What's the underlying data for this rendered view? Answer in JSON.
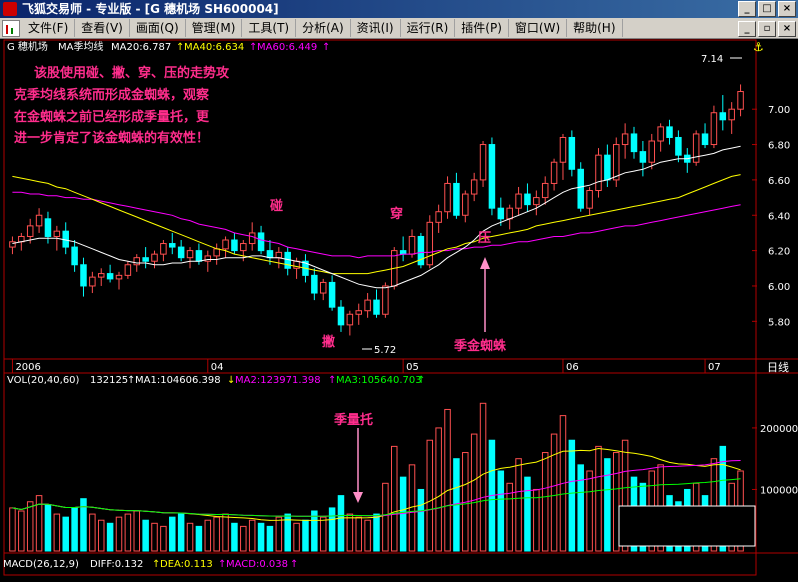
{
  "window": {
    "title": "飞狐交易师 - 专业版 - [G 穗机场 SH600004]"
  },
  "menu": [
    "文件(F)",
    "查看(V)",
    "画面(Q)",
    "管理(M)",
    "工具(T)",
    "分析(A)",
    "资讯(I)",
    "运行(R)",
    "插件(P)",
    "窗口(W)",
    "帮助(H)"
  ],
  "colors": {
    "up": "#ff5050",
    "down": "#00ffff",
    "ma20": "#ffffff",
    "ma40": "#ffff00",
    "ma60": "#ff00ff",
    "annotation": "#ff2d8c",
    "axis": "#b00000"
  },
  "price_header": {
    "stock": "G 穗机场",
    "indicator": "MA季均线",
    "ma20": "MA20:6.787",
    "ma40": "MA40:6.634",
    "ma60": "MA60:6.449"
  },
  "annotation_text": [
    "该股使用碰、撇、穿、压的走势攻",
    "克季均线系统而形成金蜘蛛，观察",
    "在金蜘蛛之前已经形成季量托，更",
    "进一步肯定了该金蜘蛛的有效性！"
  ],
  "labels": {
    "peng": "碰",
    "pie": "撇",
    "chuan": "穿",
    "ya": "压",
    "jijinzhizhu": "季金蜘蛛",
    "jiliangtuo": "季量托",
    "low": "5.72",
    "high": "7.14"
  },
  "price_axis": [
    "7.00",
    "6.80",
    "6.60",
    "6.40",
    "6.20",
    "6.00",
    "5.80"
  ],
  "date_axis": [
    "2006",
    "04",
    "05",
    "06",
    "07"
  ],
  "period_label": "日线",
  "vol_header": {
    "name": "VOL(20,40,60)",
    "value": "132125",
    "ma1": "MA1:104606.398",
    "ma2": "MA2:123971.398",
    "ma3": "MA3:105640.703"
  },
  "vol_axis": [
    "200000",
    "100000"
  ],
  "macd_header": {
    "name": "MACD(26,12,9)",
    "diff": "DIFF:0.132",
    "dea": "DEA:0.113",
    "macd": "MACD:0.038"
  },
  "chart_data": {
    "type": "candlestick",
    "ylim": [
      5.7,
      7.25
    ],
    "candles": [
      [
        6.22,
        6.28,
        6.18,
        6.25
      ],
      [
        6.25,
        6.3,
        6.2,
        6.28
      ],
      [
        6.28,
        6.38,
        6.24,
        6.34
      ],
      [
        6.34,
        6.44,
        6.3,
        6.4
      ],
      [
        6.38,
        6.42,
        6.24,
        6.28
      ],
      [
        6.28,
        6.34,
        6.2,
        6.31
      ],
      [
        6.31,
        6.36,
        6.18,
        6.22
      ],
      [
        6.22,
        6.26,
        6.08,
        6.12
      ],
      [
        6.12,
        6.16,
        5.94,
        6.0
      ],
      [
        6.0,
        6.08,
        5.96,
        6.05
      ],
      [
        6.05,
        6.1,
        6.0,
        6.07
      ],
      [
        6.07,
        6.12,
        6.02,
        6.04
      ],
      [
        6.04,
        6.08,
        5.98,
        6.06
      ],
      [
        6.06,
        6.14,
        6.04,
        6.12
      ],
      [
        6.12,
        6.18,
        6.08,
        6.16
      ],
      [
        6.16,
        6.22,
        6.1,
        6.14
      ],
      [
        6.14,
        6.2,
        6.1,
        6.18
      ],
      [
        6.18,
        6.26,
        6.14,
        6.24
      ],
      [
        6.24,
        6.3,
        6.18,
        6.22
      ],
      [
        6.22,
        6.26,
        6.14,
        6.16
      ],
      [
        6.16,
        6.22,
        6.1,
        6.2
      ],
      [
        6.2,
        6.24,
        6.12,
        6.14
      ],
      [
        6.14,
        6.2,
        6.08,
        6.17
      ],
      [
        6.17,
        6.24,
        6.12,
        6.21
      ],
      [
        6.21,
        6.28,
        6.16,
        6.26
      ],
      [
        6.26,
        6.3,
        6.18,
        6.2
      ],
      [
        6.2,
        6.26,
        6.14,
        6.24
      ],
      [
        6.24,
        6.36,
        6.2,
        6.3
      ],
      [
        6.3,
        6.34,
        6.18,
        6.2
      ],
      [
        6.2,
        6.26,
        6.12,
        6.16
      ],
      [
        6.16,
        6.22,
        6.1,
        6.19
      ],
      [
        6.19,
        6.22,
        6.06,
        6.1
      ],
      [
        6.1,
        6.16,
        6.04,
        6.14
      ],
      [
        6.14,
        6.18,
        6.02,
        6.06
      ],
      [
        6.06,
        6.1,
        5.92,
        5.96
      ],
      [
        5.96,
        6.04,
        5.92,
        6.02
      ],
      [
        6.02,
        6.06,
        5.86,
        5.88
      ],
      [
        5.88,
        5.92,
        5.74,
        5.78
      ],
      [
        5.78,
        5.86,
        5.72,
        5.84
      ],
      [
        5.84,
        5.9,
        5.78,
        5.86
      ],
      [
        5.86,
        5.96,
        5.82,
        5.92
      ],
      [
        5.92,
        5.98,
        5.82,
        5.84
      ],
      [
        5.84,
        6.02,
        5.82,
        6.0
      ],
      [
        6.0,
        6.22,
        5.98,
        6.2
      ],
      [
        6.2,
        6.28,
        6.14,
        6.18
      ],
      [
        6.18,
        6.32,
        6.16,
        6.28
      ],
      [
        6.28,
        6.3,
        6.1,
        6.12
      ],
      [
        6.12,
        6.4,
        6.1,
        6.36
      ],
      [
        6.36,
        6.46,
        6.3,
        6.42
      ],
      [
        6.42,
        6.62,
        6.38,
        6.58
      ],
      [
        6.58,
        6.64,
        6.38,
        6.4
      ],
      [
        6.4,
        6.54,
        6.36,
        6.52
      ],
      [
        6.52,
        6.64,
        6.48,
        6.6
      ],
      [
        6.6,
        6.82,
        6.56,
        6.8
      ],
      [
        6.8,
        6.84,
        6.4,
        6.44
      ],
      [
        6.44,
        6.5,
        6.34,
        6.38
      ],
      [
        6.38,
        6.46,
        6.32,
        6.44
      ],
      [
        6.44,
        6.56,
        6.4,
        6.52
      ],
      [
        6.52,
        6.58,
        6.42,
        6.46
      ],
      [
        6.46,
        6.54,
        6.4,
        6.5
      ],
      [
        6.5,
        6.62,
        6.46,
        6.58
      ],
      [
        6.58,
        6.72,
        6.54,
        6.7
      ],
      [
        6.7,
        6.86,
        6.6,
        6.84
      ],
      [
        6.84,
        6.88,
        6.62,
        6.66
      ],
      [
        6.66,
        6.7,
        6.42,
        6.44
      ],
      [
        6.44,
        6.56,
        6.4,
        6.54
      ],
      [
        6.54,
        6.78,
        6.5,
        6.74
      ],
      [
        6.74,
        6.8,
        6.56,
        6.6
      ],
      [
        6.6,
        6.84,
        6.56,
        6.8
      ],
      [
        6.8,
        6.92,
        6.72,
        6.86
      ],
      [
        6.86,
        6.9,
        6.72,
        6.76
      ],
      [
        6.76,
        6.82,
        6.62,
        6.7
      ],
      [
        6.7,
        6.86,
        6.66,
        6.82
      ],
      [
        6.82,
        6.92,
        6.76,
        6.9
      ],
      [
        6.9,
        6.94,
        6.8,
        6.84
      ],
      [
        6.84,
        6.88,
        6.7,
        6.74
      ],
      [
        6.74,
        6.78,
        6.64,
        6.7
      ],
      [
        6.7,
        6.88,
        6.68,
        6.86
      ],
      [
        6.86,
        6.92,
        6.78,
        6.8
      ],
      [
        6.8,
        7.02,
        6.78,
        6.98
      ],
      [
        6.98,
        7.08,
        6.88,
        6.94
      ],
      [
        6.94,
        7.04,
        6.86,
        7.0
      ],
      [
        7.0,
        7.14,
        6.96,
        7.1
      ]
    ],
    "ma20": [
      6.24,
      6.25,
      6.26,
      6.27,
      6.27,
      6.27,
      6.26,
      6.25,
      6.23,
      6.21,
      6.19,
      6.17,
      6.15,
      6.14,
      6.13,
      6.13,
      6.12,
      6.12,
      6.13,
      6.13,
      6.14,
      6.14,
      6.15,
      6.15,
      6.16,
      6.16,
      6.16,
      6.17,
      6.17,
      6.16,
      6.16,
      6.15,
      6.14,
      6.13,
      6.11,
      6.09,
      6.07,
      6.05,
      6.03,
      6.01,
      6.0,
      5.99,
      5.99,
      6.0,
      6.02,
      6.04,
      6.06,
      6.09,
      6.12,
      6.16,
      6.19,
      6.22,
      6.26,
      6.31,
      6.34,
      6.36,
      6.38,
      6.4,
      6.42,
      6.44,
      6.47,
      6.5,
      6.53,
      6.55,
      6.56,
      6.57,
      6.59,
      6.6,
      6.62,
      6.64,
      6.65,
      6.66,
      6.68,
      6.7,
      6.71,
      6.72,
      6.72,
      6.73,
      6.74,
      6.75,
      6.77,
      6.78,
      6.79
    ],
    "ma40": [
      6.62,
      6.61,
      6.6,
      6.59,
      6.58,
      6.56,
      6.55,
      6.53,
      6.51,
      6.49,
      6.47,
      6.45,
      6.43,
      6.41,
      6.39,
      6.37,
      6.35,
      6.33,
      6.31,
      6.29,
      6.27,
      6.25,
      6.23,
      6.21,
      6.2,
      6.18,
      6.17,
      6.16,
      6.15,
      6.14,
      6.13,
      6.12,
      6.11,
      6.1,
      6.09,
      6.08,
      6.07,
      6.07,
      6.07,
      6.07,
      6.07,
      6.08,
      6.09,
      6.1,
      6.11,
      6.13,
      6.15,
      6.17,
      6.19,
      6.21,
      6.22,
      6.24,
      6.25,
      6.27,
      6.28,
      6.29,
      6.3,
      6.31,
      6.32,
      6.34,
      6.35,
      6.36,
      6.37,
      6.38,
      6.39,
      6.4,
      6.41,
      6.42,
      6.43,
      6.44,
      6.45,
      6.46,
      6.47,
      6.48,
      6.49,
      6.5,
      6.52,
      6.54,
      6.56,
      6.58,
      6.6,
      6.62,
      6.63
    ],
    "ma60": [
      6.53,
      6.53,
      6.52,
      6.52,
      6.51,
      6.51,
      6.5,
      6.5,
      6.49,
      6.49,
      6.48,
      6.47,
      6.46,
      6.45,
      6.44,
      6.43,
      6.42,
      6.41,
      6.4,
      6.38,
      6.37,
      6.35,
      6.34,
      6.33,
      6.32,
      6.3,
      6.29,
      6.28,
      6.26,
      6.25,
      6.24,
      6.22,
      6.21,
      6.2,
      6.19,
      6.18,
      6.17,
      6.17,
      6.17,
      6.16,
      6.17,
      6.17,
      6.17,
      6.17,
      6.18,
      6.18,
      6.19,
      6.19,
      6.2,
      6.2,
      6.21,
      6.21,
      6.22,
      6.22,
      6.23,
      6.23,
      6.24,
      6.25,
      6.25,
      6.26,
      6.27,
      6.28,
      6.28,
      6.29,
      6.3,
      6.3,
      6.31,
      6.32,
      6.33,
      6.34,
      6.34,
      6.35,
      6.36,
      6.37,
      6.38,
      6.39,
      6.4,
      6.41,
      6.42,
      6.43,
      6.44,
      6.45,
      6.46
    ],
    "volume": [
      70000,
      65000,
      80000,
      90000,
      75000,
      60000,
      55000,
      70000,
      85000,
      60000,
      50000,
      45000,
      55000,
      60000,
      65000,
      50000,
      45000,
      40000,
      55000,
      60000,
      45000,
      40000,
      50000,
      55000,
      60000,
      45000,
      40000,
      50000,
      45000,
      40000,
      55000,
      60000,
      45000,
      50000,
      65000,
      55000,
      70000,
      90000,
      60000,
      55000,
      50000,
      60000,
      110000,
      170000,
      120000,
      140000,
      100000,
      180000,
      200000,
      230000,
      150000,
      160000,
      190000,
      240000,
      180000,
      130000,
      110000,
      150000,
      120000,
      100000,
      160000,
      190000,
      220000,
      180000,
      140000,
      130000,
      170000,
      150000,
      160000,
      180000,
      120000,
      110000,
      130000,
      140000,
      90000,
      80000,
      100000,
      110000,
      90000,
      150000,
      170000,
      110000,
      130000
    ],
    "vol_ylim": [
      0,
      260000
    ]
  }
}
